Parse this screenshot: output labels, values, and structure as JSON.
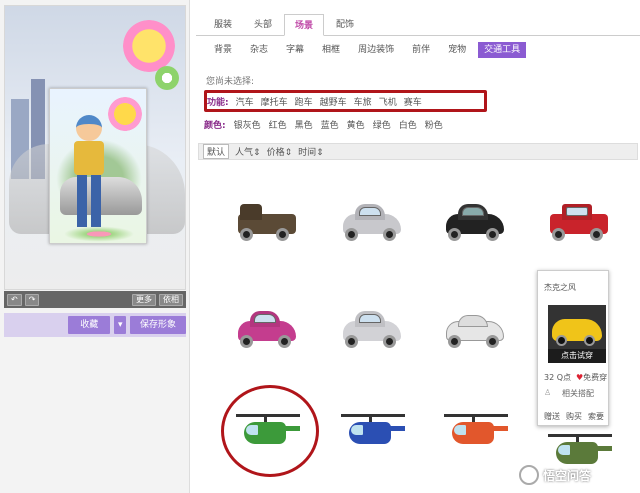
{
  "preview": {
    "more_label": "更多",
    "lock_label": "依相"
  },
  "actions": {
    "collect_label": "收藏",
    "dropdown_icon": "chevron-down-icon",
    "save_label": "保存形象"
  },
  "tabs": [
    {
      "label": "服装",
      "active": false
    },
    {
      "label": "头部",
      "active": false
    },
    {
      "label": "场景",
      "active": true
    },
    {
      "label": "配饰",
      "active": false
    }
  ],
  "subtabs": [
    {
      "label": "背景",
      "active": false
    },
    {
      "label": "杂志",
      "active": false
    },
    {
      "label": "字幕",
      "active": false
    },
    {
      "label": "相框",
      "active": false
    },
    {
      "label": "周边装饰",
      "active": false
    },
    {
      "label": "前伴",
      "active": false
    },
    {
      "label": "宠物",
      "active": false
    },
    {
      "label": "交通工具",
      "active": true
    }
  ],
  "filters": {
    "chosen_label": "您尚未选择:",
    "function_label": "功能:",
    "function_options": [
      "汽车",
      "摩托车",
      "跑车",
      "越野车",
      "车旅",
      "飞机",
      "赛车"
    ],
    "color_label": "颜色:",
    "color_options": [
      "银灰色",
      "红色",
      "黑色",
      "蓝色",
      "黄色",
      "绿色",
      "白色",
      "粉色"
    ]
  },
  "sort": {
    "options": [
      "默认",
      "人气",
      "价格",
      "时间"
    ],
    "active": "默认"
  },
  "colors": {
    "accent": "#8b5bd2",
    "tab_active": "#c14da9",
    "highlight": "#b0151a"
  },
  "popup": {
    "title": "杰克之风",
    "try_on_label": "点击试穿",
    "price": "32 Q点",
    "free_label": "免费穿",
    "match_label": "相关搭配",
    "actions": [
      "赠送",
      "购买",
      "索要"
    ]
  },
  "watermark": {
    "text": "悟空问答"
  }
}
